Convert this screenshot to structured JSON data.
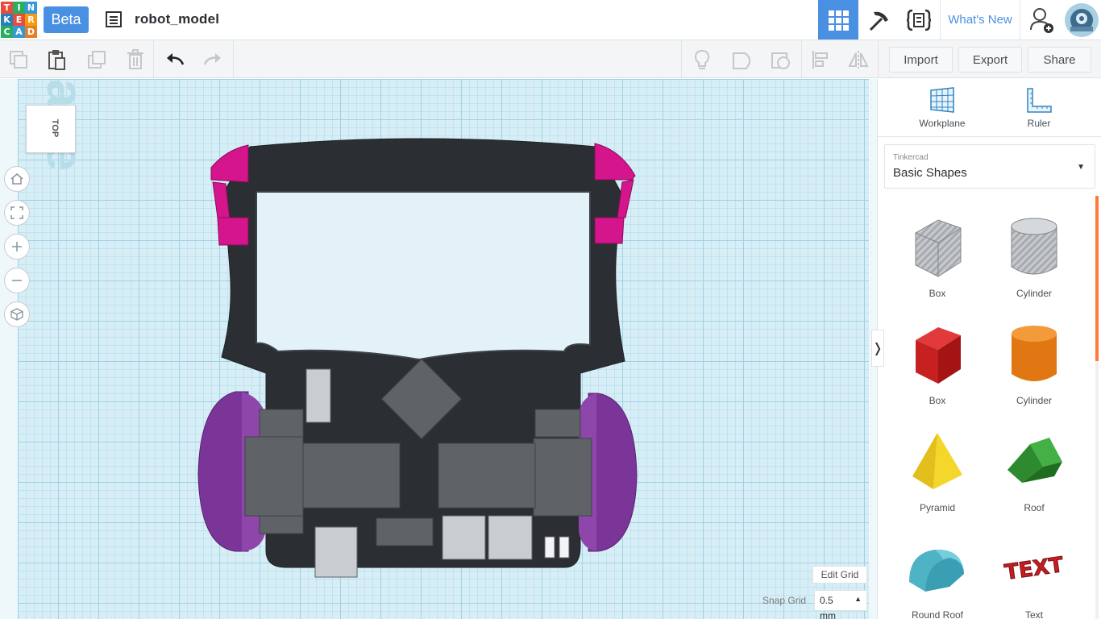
{
  "header": {
    "logo_letters": [
      "T",
      "I",
      "N",
      "K",
      "E",
      "R",
      "C",
      "A",
      "D"
    ],
    "logo_colors": [
      "#e74c3c",
      "#27ae60",
      "#3498db",
      "#2980b9",
      "#e74c3c",
      "#f39c12",
      "#27ae60",
      "#3498db",
      "#e67e22"
    ],
    "beta_label": "Beta",
    "doc_title": "robot_model",
    "whats_new": "What's New"
  },
  "toolbar": {
    "import_label": "Import",
    "export_label": "Export",
    "share_label": "Share"
  },
  "workplane": {
    "watermark": "ane",
    "viewcube_label": "TOP",
    "edit_grid_label": "Edit Grid",
    "snap_grid_label": "Snap Grid",
    "snap_grid_value": "0.5",
    "snap_grid_unit": "mm"
  },
  "panel": {
    "workplane_label": "Workplane",
    "ruler_label": "Ruler",
    "category_caption": "Tinkercad",
    "category_value": "Basic Shapes",
    "shapes": [
      {
        "label": "Box",
        "icon": "box-striped-icon"
      },
      {
        "label": "Cylinder",
        "icon": "cylinder-striped-icon"
      },
      {
        "label": "Box",
        "icon": "box-red-icon"
      },
      {
        "label": "Cylinder",
        "icon": "cylinder-orange-icon"
      },
      {
        "label": "Pyramid",
        "icon": "pyramid-icon"
      },
      {
        "label": "Roof",
        "icon": "roof-icon"
      },
      {
        "label": "Round Roof",
        "icon": "round-roof-icon"
      },
      {
        "label": "Text",
        "icon": "text-shape-icon"
      }
    ],
    "text_shape_word": "TEXT"
  },
  "colors": {
    "accent": "#4a90e2",
    "body": "#2b2f33",
    "magenta": "#d4158c",
    "purple": "#7b3598",
    "gray_part": "#5f6368",
    "light_part": "#c9cdd2"
  }
}
